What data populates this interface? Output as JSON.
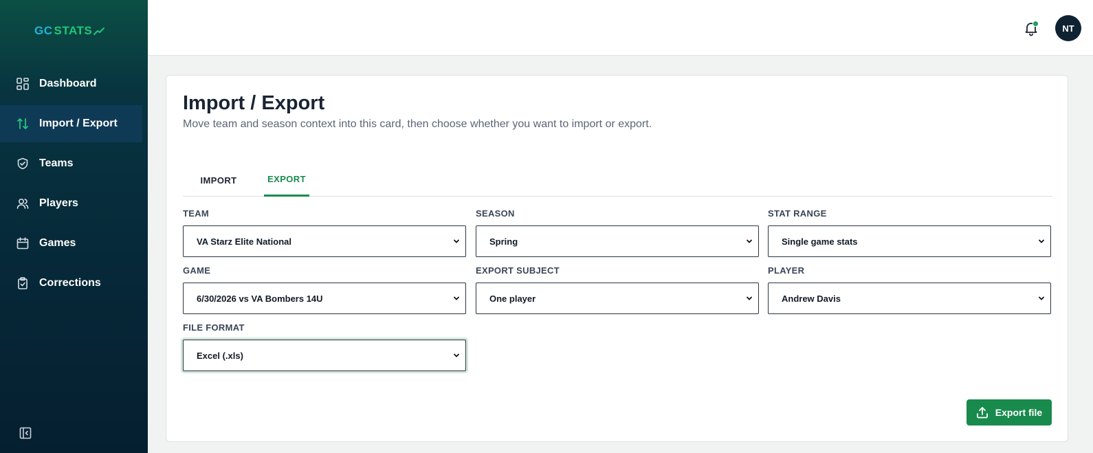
{
  "brand": {
    "part1": "GC",
    "part2": "STATS"
  },
  "sidebar": {
    "items": [
      {
        "label": "Dashboard",
        "icon": "dashboard-icon"
      },
      {
        "label": "Import / Export",
        "icon": "import-export-icon",
        "active": true
      },
      {
        "label": "Teams",
        "icon": "shield-icon"
      },
      {
        "label": "Players",
        "icon": "users-icon"
      },
      {
        "label": "Games",
        "icon": "calendar-icon"
      },
      {
        "label": "Corrections",
        "icon": "clipboard-check-icon"
      }
    ]
  },
  "topbar": {
    "avatar_initials": "NT",
    "notification_dot": true
  },
  "page": {
    "title": "Import / Export",
    "subtitle": "Move team and season context into this card, then choose whether you want to import or export."
  },
  "tabs": [
    {
      "label": "IMPORT",
      "active": false
    },
    {
      "label": "EXPORT",
      "active": true
    }
  ],
  "form": {
    "team": {
      "label": "TEAM",
      "value": "VA Starz Elite National"
    },
    "season": {
      "label": "SEASON",
      "value": "Spring"
    },
    "stat_range": {
      "label": "STAT RANGE",
      "value": "Single game stats"
    },
    "game": {
      "label": "GAME",
      "value": "6/30/2026 vs VA Bombers 14U"
    },
    "export_subject": {
      "label": "EXPORT SUBJECT",
      "value": "One player"
    },
    "player": {
      "label": "PLAYER",
      "value": "Andrew Davis"
    },
    "file_format": {
      "label": "FILE FORMAT",
      "value": "Excel (.xls)"
    }
  },
  "actions": {
    "export_label": "Export file"
  },
  "colors": {
    "accent": "#188a4c",
    "sidebar_bg": "#062838",
    "active_nav_bg": "#0f3a56"
  }
}
